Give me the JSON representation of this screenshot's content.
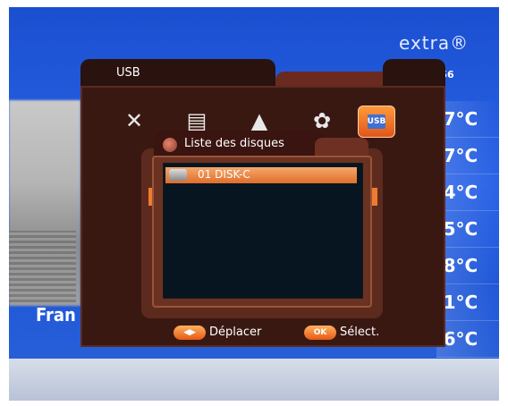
{
  "tv": {
    "logo": "extra®",
    "clock": ":56",
    "channel": "Fran",
    "temperatures": [
      ".7°C",
      ".7°C",
      ".4°C",
      ".5°C",
      ".8°C",
      ".1°C",
      ".6°C"
    ]
  },
  "menu": {
    "title": "USB",
    "panel_title": "Liste des disques",
    "disks": [
      {
        "label": "01 DISK-C",
        "selected": true
      }
    ],
    "footer": {
      "move_icon": "◀▶",
      "move_label": "Déplacer",
      "ok_icon": "OK",
      "ok_label": "Sélect."
    },
    "icons": [
      "tools-icon",
      "document-icon",
      "satellite-icon",
      "gears-icon",
      "usb-icon"
    ],
    "usb_icon_text": "USB",
    "accent_color": "#e06d2a"
  }
}
